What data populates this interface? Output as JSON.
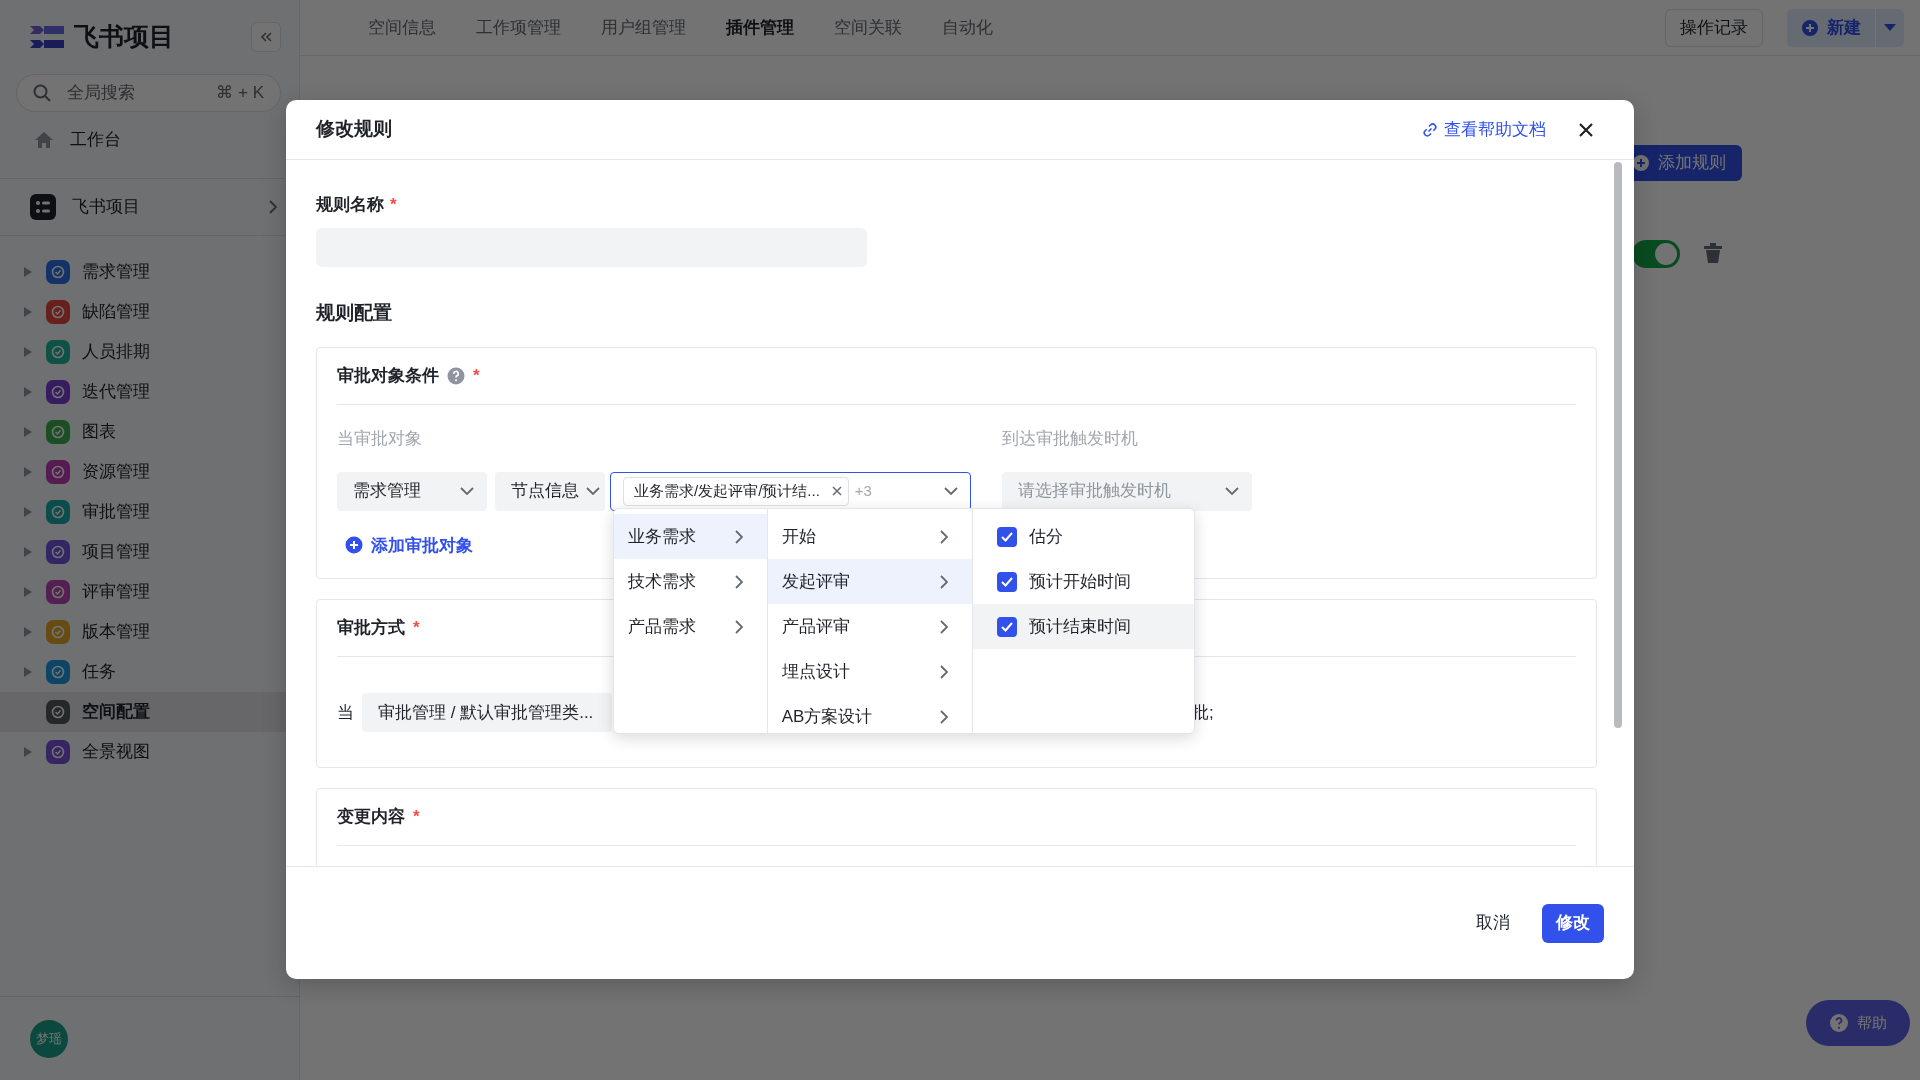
{
  "sidebar": {
    "logo": "飞书项目",
    "search": {
      "placeholder": "全局搜索",
      "shortcut": "⌘ + K"
    },
    "workbench": "工作台",
    "space": "飞书项目",
    "items": [
      {
        "label": "需求管理",
        "color": "#153268",
        "expandable": true,
        "selected": false
      },
      {
        "label": "缺陷管理",
        "color": "#67201c",
        "expandable": true,
        "selected": false
      },
      {
        "label": "人员排期",
        "color": "#0e5146",
        "expandable": true,
        "selected": false
      },
      {
        "label": "迭代管理",
        "color": "#371d60",
        "expandable": true,
        "selected": false
      },
      {
        "label": "图表",
        "color": "#1c4e24",
        "expandable": true,
        "selected": false
      },
      {
        "label": "资源管理",
        "color": "#561b52",
        "expandable": true,
        "selected": false
      },
      {
        "label": "审批管理",
        "color": "#0b4c4c",
        "expandable": true,
        "selected": false
      },
      {
        "label": "项目管理",
        "color": "#322665",
        "expandable": true,
        "selected": false
      },
      {
        "label": "评审管理",
        "color": "#532051",
        "expandable": true,
        "selected": false
      },
      {
        "label": "版本管理",
        "color": "#664c13",
        "expandable": true,
        "selected": false
      },
      {
        "label": "任务",
        "color": "#0c4565",
        "expandable": true,
        "selected": false
      },
      {
        "label": "空间配置",
        "color": "#262729",
        "expandable": false,
        "selected": true
      },
      {
        "label": "全景视图",
        "color": "#372463",
        "expandable": true,
        "selected": false
      }
    ],
    "avatar": "梦瑶"
  },
  "top_nav": {
    "tabs": [
      {
        "label": "空间信息",
        "selected": false
      },
      {
        "label": "工作项管理",
        "selected": false
      },
      {
        "label": "用户组管理",
        "selected": false
      },
      {
        "label": "插件管理",
        "selected": true
      },
      {
        "label": "空间关联",
        "selected": false
      },
      {
        "label": "自动化",
        "selected": false
      }
    ],
    "history_button": "操作记录",
    "new_button": "新建"
  },
  "background": {
    "add_rule_button": "添加规则",
    "rule_toggle": {
      "on": true
    }
  },
  "help_button": "帮助",
  "modal": {
    "title": "修改规则",
    "help_link": "查看帮助文档",
    "name_field": {
      "label": "规则名称",
      "required_mark": "*"
    },
    "config_heading": "规则配置",
    "target_section": {
      "title": "审批对象条件",
      "required_mark": "*",
      "target_label": "当审批对象",
      "trigger_label": "到达审批触发时机",
      "selects": [
        {
          "value": "需求管理"
        },
        {
          "value": "节点信息"
        }
      ],
      "multi_select": {
        "tag": "业务需求/发起评审/预计结...",
        "more": "+3",
        "focused": true
      },
      "trigger_select": {
        "placeholder": "请选择审批触发时机"
      },
      "add_link": "添加审批对象"
    },
    "method_section": {
      "title": "审批方式",
      "required_mark": "*",
      "prefix": "当",
      "select": "审批管理 / 默认审批管理类...",
      "suffix": "批;"
    },
    "change_section": {
      "title": "变更内容",
      "required_mark": "*"
    },
    "cascader": {
      "columns": [
        {
          "kind": "menu",
          "items": [
            {
              "label": "业务需求",
              "selected": true
            },
            {
              "label": "技术需求",
              "selected": false
            },
            {
              "label": "产品需求",
              "selected": false
            }
          ]
        },
        {
          "kind": "menu",
          "items": [
            {
              "label": "开始",
              "selected": false
            },
            {
              "label": "发起评审",
              "selected": true
            },
            {
              "label": "产品评审",
              "selected": false
            },
            {
              "label": "埋点设计",
              "selected": false
            },
            {
              "label": "AB方案设计",
              "selected": false
            }
          ]
        },
        {
          "kind": "checklist",
          "items": [
            {
              "label": "估分",
              "checked": true,
              "hovered": false
            },
            {
              "label": "预计开始时间",
              "checked": true,
              "hovered": false
            },
            {
              "label": "预计结束时间",
              "checked": true,
              "hovered": true
            }
          ]
        }
      ]
    },
    "cancel_button": "取消",
    "submit_button": "修改"
  }
}
